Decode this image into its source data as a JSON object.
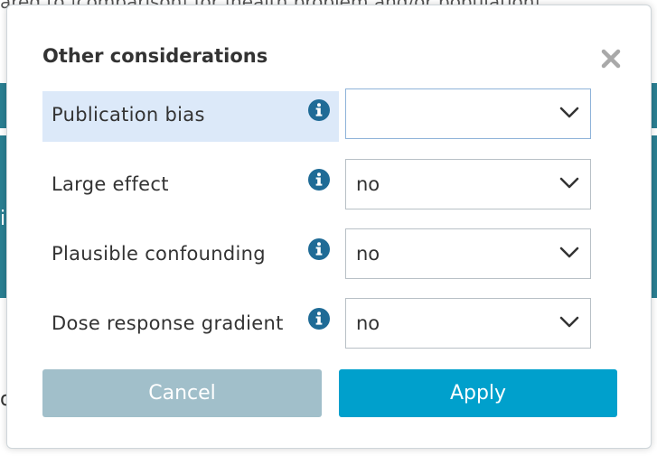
{
  "background": {
    "top_text": "ared to |comparison| for |health problem and/or population|",
    "partial_left_letter_1": "i",
    "partial_left_letter_2": "o"
  },
  "modal": {
    "title": "Other considerations",
    "close_icon": "close-icon",
    "rows": [
      {
        "label": "Publication bias",
        "value": "",
        "highlighted": true,
        "info_icon": "info-icon"
      },
      {
        "label": "Large effect",
        "value": "no",
        "highlighted": false,
        "info_icon": "info-icon"
      },
      {
        "label": "Plausible confounding",
        "value": "no",
        "highlighted": false,
        "info_icon": "info-icon"
      },
      {
        "label": "Dose response gradient",
        "value": "no",
        "highlighted": false,
        "info_icon": "info-icon"
      }
    ],
    "cancel_label": "Cancel",
    "apply_label": "Apply"
  },
  "colors": {
    "accent": "#00a0cc",
    "cancel_disabled": "#a1bfca",
    "highlight_row": "#dce9f9",
    "info_icon": "#1f6b96",
    "background_band": "#2a7f92"
  }
}
